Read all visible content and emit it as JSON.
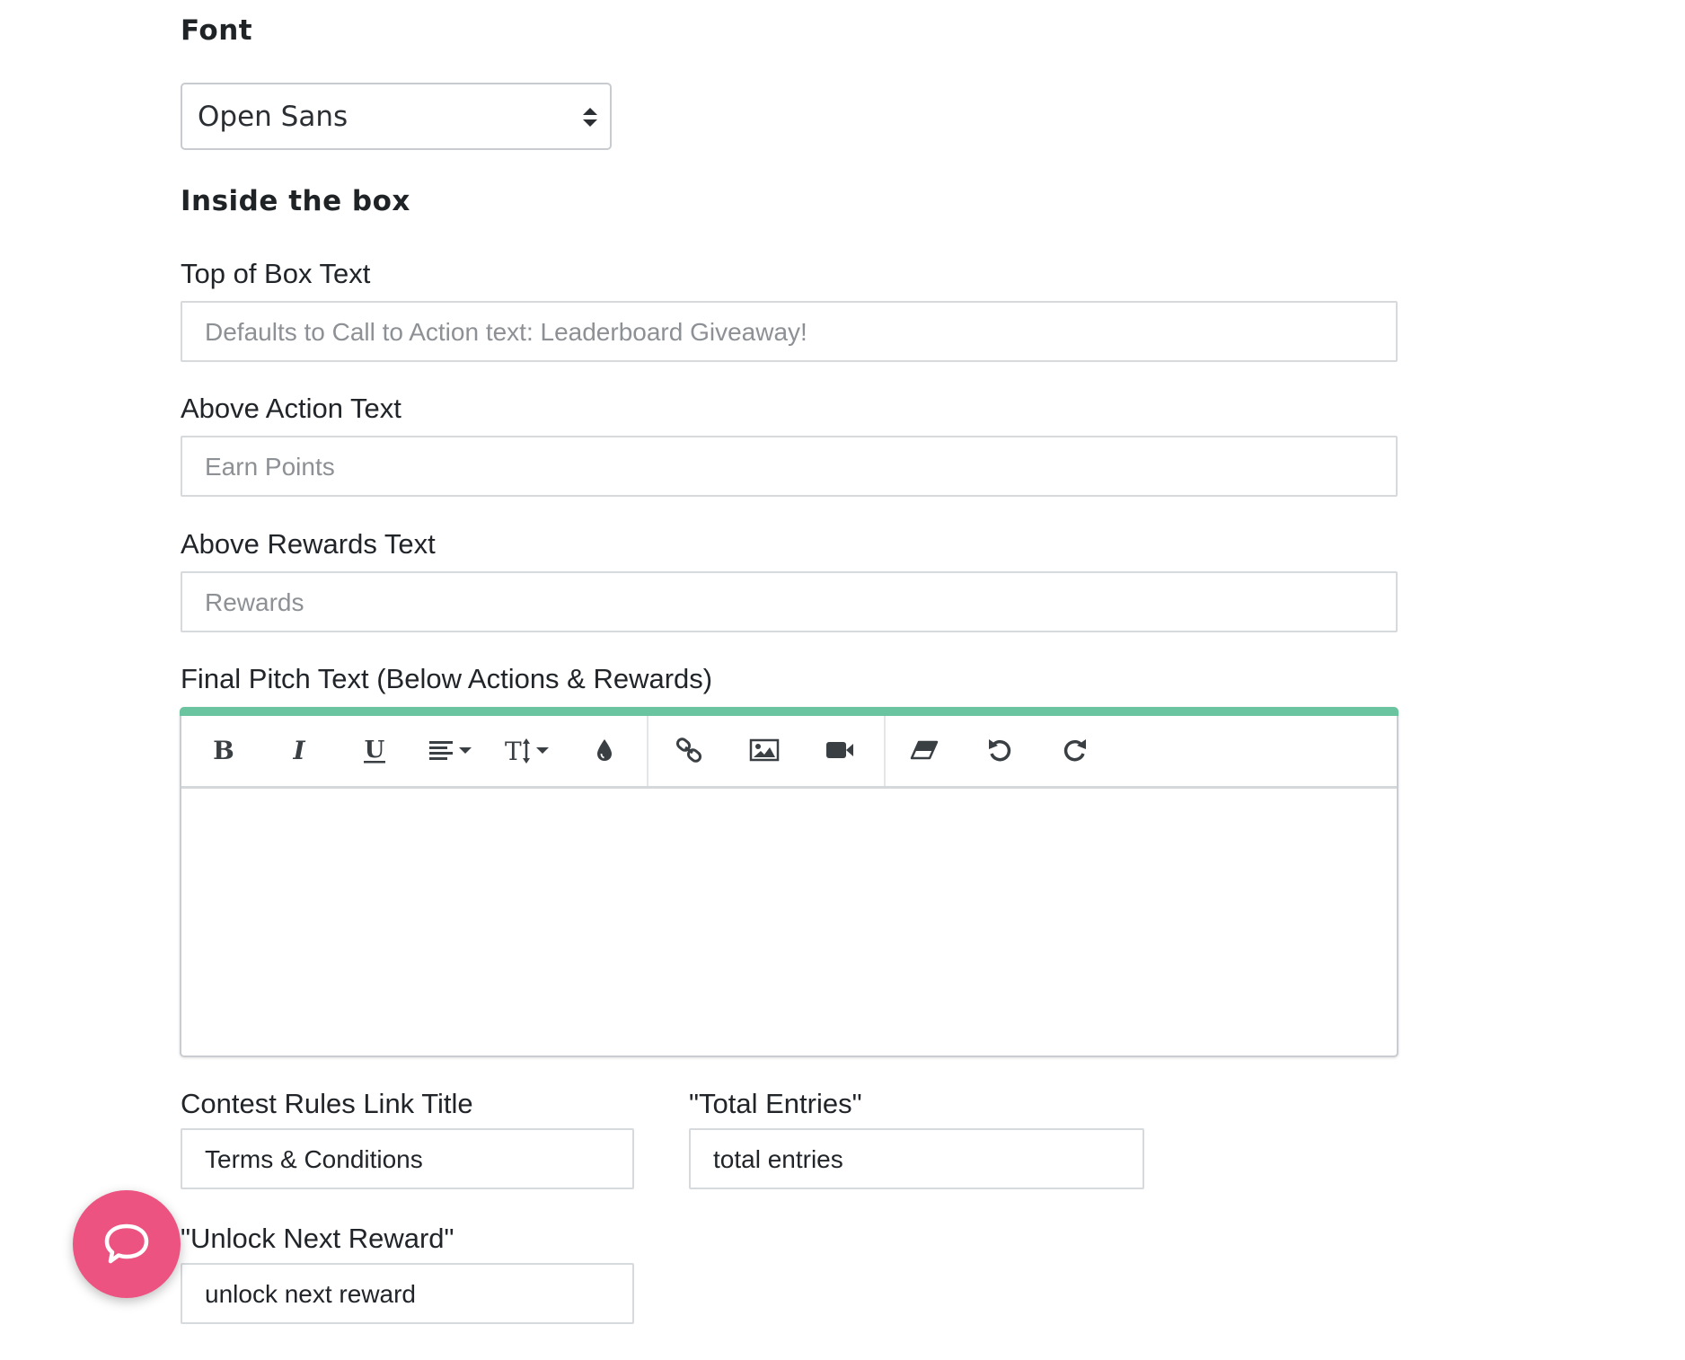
{
  "font_section": {
    "heading": "Font",
    "selected_font": "Open Sans"
  },
  "inside_box": {
    "heading": "Inside the box",
    "top_of_box": {
      "label": "Top of Box Text",
      "placeholder": "Defaults to Call to Action text: Leaderboard Giveaway!"
    },
    "above_action": {
      "label": "Above Action Text",
      "placeholder": "Earn Points"
    },
    "above_rewards": {
      "label": "Above Rewards Text",
      "placeholder": "Rewards"
    },
    "final_pitch": {
      "label": "Final Pitch Text (Below Actions & Rewards)",
      "accent_color": "#6bc4a0",
      "toolbar": [
        "bold-icon",
        "italic-icon",
        "underline-icon",
        "align-dropdown-icon",
        "text-size-dropdown-icon",
        "color-drop-icon",
        "link-icon",
        "image-icon",
        "video-icon",
        "eraser-icon",
        "undo-icon",
        "redo-icon"
      ]
    },
    "contest_rules": {
      "label": "Contest Rules Link Title",
      "value": "Terms & Conditions"
    },
    "total_entries": {
      "label": "\"Total Entries\"",
      "value": "total entries"
    },
    "unlock_next_reward": {
      "label": "\"Unlock Next Reward\"",
      "value": "unlock next reward"
    }
  },
  "chat": {
    "icon": "chat-bubble-icon",
    "color": "#ec5380"
  }
}
